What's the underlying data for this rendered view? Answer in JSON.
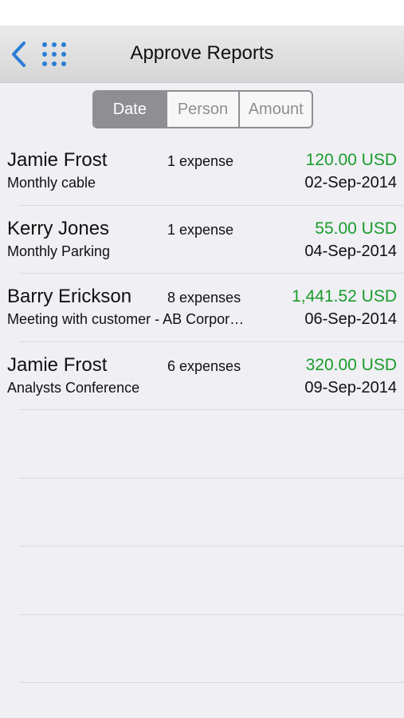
{
  "header": {
    "title": "Approve Reports",
    "back_icon": "chevron-left-icon",
    "menu_icon": "grid-dots-icon",
    "accent_color": "#2a7dd6"
  },
  "sort_tabs": {
    "items": [
      "Date",
      "Person",
      "Amount"
    ],
    "selected": "Date"
  },
  "reports": [
    {
      "name": "Jamie Frost",
      "count": "1 expense",
      "amount": "120.00 USD",
      "description": "Monthly cable",
      "date": "02-Sep-2014"
    },
    {
      "name": "Kerry Jones",
      "count": "1 expense",
      "amount": "55.00 USD",
      "description": "Monthly Parking",
      "date": "04-Sep-2014"
    },
    {
      "name": "Barry Erickson",
      "count": "8 expenses",
      "amount": "1,441.52 USD",
      "description": "Meeting with customer - AB Corpor…",
      "date": "06-Sep-2014"
    },
    {
      "name": "Jamie Frost",
      "count": "6 expenses",
      "amount": "320.00 USD",
      "description": "Analysts Conference",
      "date": "09-Sep-2014"
    }
  ],
  "colors": {
    "amount": "#1a9c2b",
    "background": "#efeff4"
  }
}
